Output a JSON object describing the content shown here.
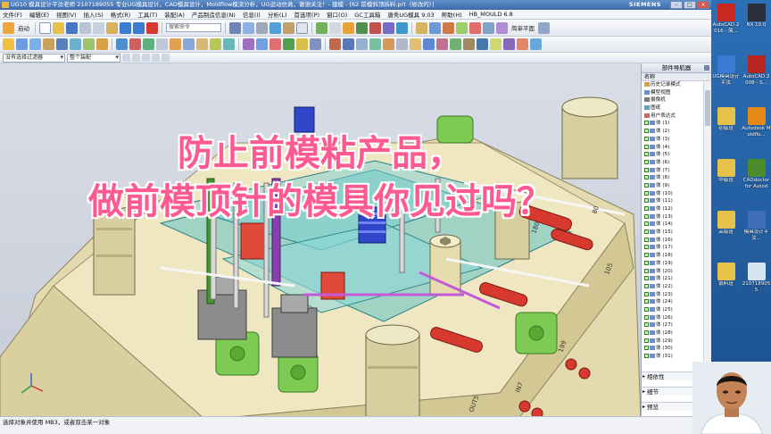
{
  "window": {
    "title": "UG10 模具设计平汝老师 2107189055 专业UG模具设计，CAD模具设计，Moldflow模流分析，UG运动仿真，谢谢关注！- 建模 - [62 前模斜顶拆料.prt（修改的）]",
    "brand": "SIEMENS",
    "controls": [
      "–",
      "□",
      "×"
    ]
  },
  "menubar": {
    "items": [
      "文件(F)",
      "编辑(E)",
      "视图(V)",
      "插入(S)",
      "格式(R)",
      "工具(T)",
      "装配(A)",
      "产品制造信息(N)",
      "信息(I)",
      "分析(L)",
      "首选项(P)",
      "窗口(O)",
      "GC工具箱",
      "唐秀UG模具 9.03",
      "帮助(H)",
      "HB_MOULD 6.8"
    ]
  },
  "toolbar1": {
    "start_label": "启动",
    "search_placeholder": "搜索命令",
    "right_label": "简单平面"
  },
  "toolbar3": {
    "selection_filter": "没有选择过滤器",
    "assembly_scope": "整个装配"
  },
  "overlay": {
    "line1": "防止前模粘产品，",
    "line2": "做前模顶针的模具你见过吗？"
  },
  "scene": {
    "labels": [
      "105",
      "199",
      "180",
      "80",
      "OUT5",
      "IN7"
    ],
    "colors": {
      "plate": "#ece3b8",
      "plate_top": "#f3edc8",
      "transparent_plate": "#5fc2c7",
      "pillar": "#d8cfa0",
      "red_pin": "#d8392f",
      "green_block": "#7ecb54",
      "spring_blue": "#2f46c9",
      "purple_rod": "#8a3fae"
    }
  },
  "statusbar": {
    "line1": "选择对象并使用 MB3，或者双击某一对象",
    "line2": ""
  },
  "navigator": {
    "title": "部件导航器",
    "column_header": "名称",
    "top_items": [
      "历史记录模式",
      "模型视图",
      "摄像机",
      "图纸",
      "用户表达式"
    ],
    "bodies": [
      "体 (1)",
      "体 (2)",
      "体 (3)",
      "体 (4)",
      "体 (5)",
      "体 (6)",
      "体 (7)",
      "体 (8)",
      "体 (9)",
      "体 (10)",
      "体 (11)",
      "体 (12)",
      "体 (13)",
      "体 (14)",
      "体 (15)",
      "体 (16)",
      "体 (17)",
      "体 (18)",
      "体 (19)",
      "体 (20)",
      "体 (21)",
      "体 (22)",
      "体 (23)",
      "体 (24)",
      "体 (25)",
      "体 (26)",
      "体 (27)",
      "体 (28)",
      "体 (29)",
      "体 (30)",
      "体 (31)"
    ],
    "sections": [
      "相依性",
      "细节",
      "预览"
    ]
  },
  "desktop": {
    "icons": [
      {
        "label": "AutoCAD 2016 - 简...",
        "color": "#c8281e"
      },
      {
        "label": "NX 10.0",
        "color": "#2a2f3a"
      },
      {
        "label": "UG模具设计平汝",
        "color": "#3a7bd5"
      },
      {
        "label": "AutoCAD 2008 - S...",
        "color": "#b52620"
      },
      {
        "label": "初级班",
        "color": "#e7c24a"
      },
      {
        "label": "Autodesk Moldflo...",
        "color": "#e38a18"
      },
      {
        "label": "中级班",
        "color": "#e7c24a"
      },
      {
        "label": "CADdoctor for Autode...",
        "color": "#4d8c2a"
      },
      {
        "label": "高级班",
        "color": "#e7c24a"
      },
      {
        "label": "模具设计平汝...",
        "color": "#3e6fb8"
      },
      {
        "label": "锻料班",
        "color": "#e7c24a"
      },
      {
        "label": "2107189055",
        "color": "#d9e4f2"
      }
    ]
  }
}
